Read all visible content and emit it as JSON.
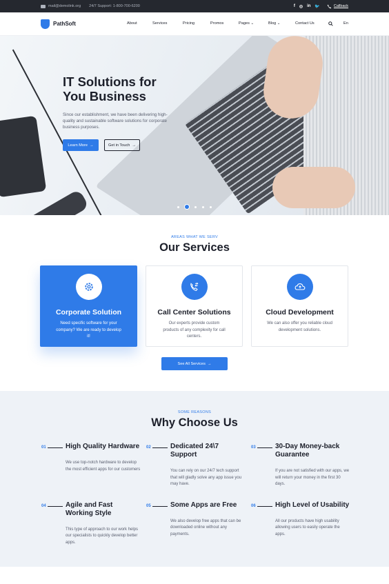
{
  "topbar": {
    "email": "mail@demolink.org",
    "support": "24/7 Support: 1-800-700-6200",
    "social": [
      "f",
      "◎",
      "in",
      "🐦"
    ],
    "callback": "Callback"
  },
  "nav": {
    "brand": "PathSoft",
    "items": [
      "About",
      "Services",
      "Pricing",
      "Promos",
      "Pages",
      "Blog",
      "Contact Us"
    ],
    "language": "En"
  },
  "hero": {
    "title": "IT Solutions for You Business",
    "description": "Since our establishment, we have been delivering high-quality and sustainable software solutions for corporate business purposes.",
    "primary_button": "Learn More",
    "secondary_button": "Get in Touch",
    "slides_total": 5,
    "active_slide": 1
  },
  "services": {
    "kicker": "AREAS WHAT WE SERV",
    "title": "Our Services",
    "cards": [
      {
        "icon": "gear-icon",
        "title": "Corporate Solution",
        "description": "Need specific software for your company? We are ready to develop it!"
      },
      {
        "icon": "phone-transfer-icon",
        "title": "Call Center Solutions",
        "description": "Our experts provide custom products of any complexity for call centers."
      },
      {
        "icon": "cloud-upload-icon",
        "title": "Cloud Development",
        "description": "We can also offer you reliable cloud development solutions."
      }
    ],
    "see_all": "See All Services"
  },
  "why": {
    "kicker": "SOME REASONS",
    "title": "Why Choose Us",
    "features": [
      {
        "num": "01",
        "title": "High Quality Hardware",
        "description": "We use top-notch hardware to develop the most efficient apps for our customers"
      },
      {
        "num": "02",
        "title": "Dedicated 24\\7 Support",
        "description": "You can rely on our 24/7 tech support that will gladly solve any app issue you may have."
      },
      {
        "num": "03",
        "title": "30-Day Money-back Guarantee",
        "description": "If you are not satisfied with our apps, we will return your money in the first 30 days."
      },
      {
        "num": "04",
        "title": "Agile and Fast Working Style",
        "description": "This type of approach to our work helps our specialists to quickly develop better apps."
      },
      {
        "num": "05",
        "title": "Some Apps are Free",
        "description": "We also develop free apps that can be downloaded online without any payments."
      },
      {
        "num": "06",
        "title": "High Level of Usability",
        "description": "All our products have high usability allowing users to easily operate the apps."
      }
    ]
  },
  "colors": {
    "accent": "#2f7be8",
    "topbar": "#25282f",
    "section_bg": "#eef2f7"
  }
}
